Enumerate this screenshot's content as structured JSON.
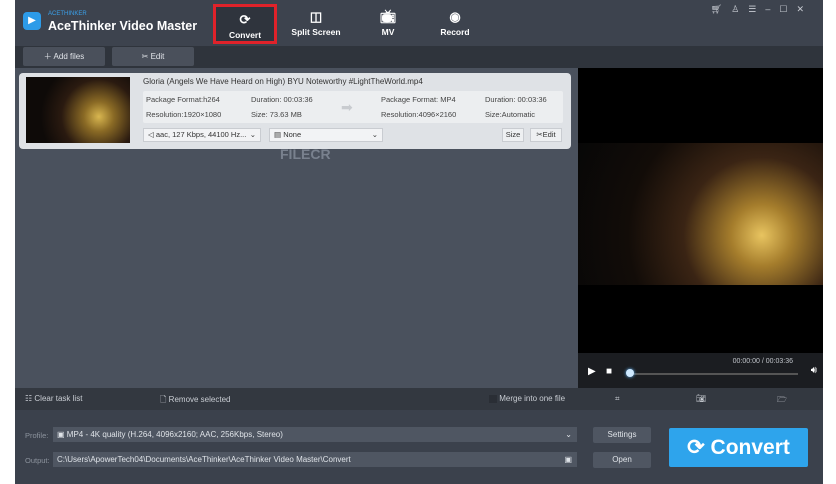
{
  "app": {
    "brand_small": "ACETHINKER",
    "title": "AceThinker Video Master"
  },
  "nav": [
    {
      "label": "Convert",
      "icon": "refresh-icon"
    },
    {
      "label": "Split Screen",
      "icon": "split-screen-icon"
    },
    {
      "label": "MV",
      "icon": "tv-icon"
    },
    {
      "label": "Record",
      "icon": "record-icon"
    }
  ],
  "toolbar": {
    "add_files": "Add files",
    "edit": "Edit"
  },
  "file": {
    "name": "Gloria (Angels We Have Heard on High)  BYU Noteworthy  #LightTheWorld.mp4",
    "src_format": "Package Format:h264",
    "src_duration": "Duration: 00:03:36",
    "src_resolution": "Resolution:1920×1080",
    "src_size": "Size: 73.63 MB",
    "dst_format": "Package Format: MP4",
    "dst_duration": "Duration: 00:03:36",
    "dst_resolution": "Resolution:4096×2160",
    "dst_size": "Size:Automatic",
    "audio": "aac, 127 Kbps, 44100 Hz...",
    "subtitle": "None",
    "size_btn": "Size",
    "edit_btn": "Edit"
  },
  "watermark": "FILECR",
  "player": {
    "time": "00:00:00 / 00:03:36"
  },
  "bottom": {
    "clear": "Clear task list",
    "remove": "Remove selected",
    "merge": "Merge into one file"
  },
  "profile": {
    "profile_label": "Profile:",
    "profile_value": "MP4 - 4K quality (H.264, 4096x2160; AAC, 256Kbps, Stereo)",
    "output_label": "Output:",
    "output_value": "C:\\Users\\ApowerTech04\\Documents\\AceThinker\\AceThinker Video Master\\Convert",
    "settings": "Settings",
    "open": "Open",
    "convert": "Convert"
  },
  "colors": {
    "accent": "#2ea4ec",
    "highlight": "#e0222a"
  }
}
